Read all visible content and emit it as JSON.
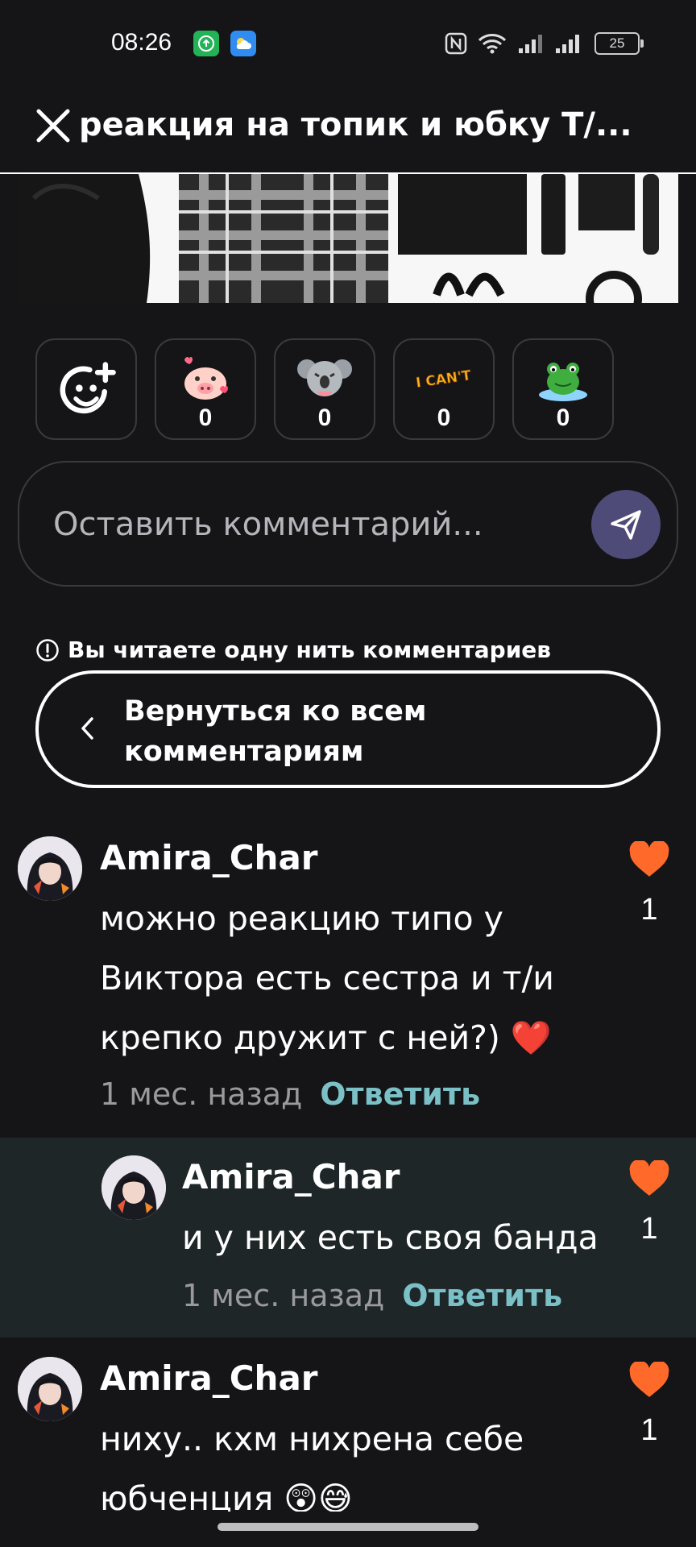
{
  "status_bar": {
    "time": "08:26",
    "battery": "25",
    "icons": [
      "upload-app-icon",
      "weather-app-icon",
      "nfc-icon",
      "wifi-icon",
      "signal-icon",
      "signal-icon",
      "battery-icon"
    ]
  },
  "header": {
    "title": "реакция на топик и юбку Т/...",
    "close_icon": "close-icon"
  },
  "reactions": [
    {
      "icon": "add-reaction-icon",
      "count": null
    },
    {
      "icon": "pig-sticker",
      "count": "0"
    },
    {
      "icon": "koala-sticker",
      "count": "0"
    },
    {
      "icon": "i-cant-sticker",
      "label": "I CAN'T",
      "count": "0"
    },
    {
      "icon": "frog-sticker",
      "count": "0"
    }
  ],
  "comment_input": {
    "placeholder": "Оставить комментарий..."
  },
  "thread": {
    "notice": "Вы читаете одну нить комментариев",
    "back_label": "Вернуться ко всем комментариям"
  },
  "comments": [
    {
      "author": "Amira_Char",
      "text": "можно реакцию типо у Виктора есть сестра и т/и крепко дружит с ней?) ❤️",
      "time": "1 мес. назад",
      "reply_label": "Ответить",
      "likes": "1"
    },
    {
      "author": "Amira_Char",
      "text": "и у них есть своя банда",
      "time": "1 мес. назад",
      "reply_label": "Ответить",
      "likes": "1"
    },
    {
      "author": "Amira_Char",
      "text": "ниху.. кхм нихрена себе юбченция 😲😅",
      "likes": "1"
    }
  ],
  "colors": {
    "background": "#151417",
    "reply_background": "#1e2628",
    "like_heart": "#ff6a2b",
    "reply_link": "#7ac0c6",
    "send_button": "#4f4b78"
  }
}
